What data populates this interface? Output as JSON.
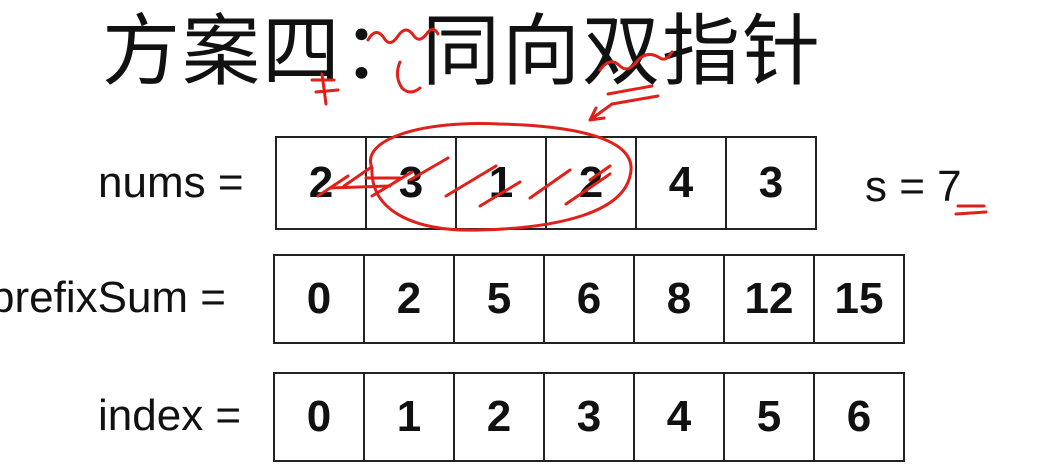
{
  "title": "方案四：同向双指针",
  "rows": {
    "nums": {
      "label": "nums =",
      "values": [
        "2",
        "3",
        "1",
        "2",
        "4",
        "3"
      ]
    },
    "prefix": {
      "label": "prefixSum =",
      "values": [
        "0",
        "2",
        "5",
        "6",
        "8",
        "12",
        "15"
      ]
    },
    "index": {
      "label": "index =",
      "values": [
        "0",
        "1",
        "2",
        "3",
        "4",
        "5",
        "6"
      ]
    }
  },
  "target": {
    "label": "s = 7"
  },
  "annotation_color": "#e0201a"
}
